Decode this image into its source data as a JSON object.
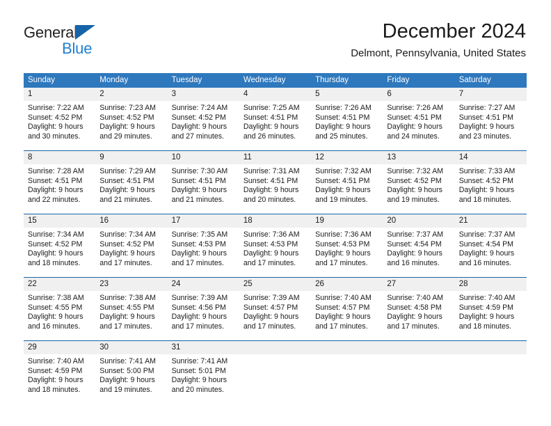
{
  "brand": {
    "name_part1": "General",
    "name_part2": "Blue",
    "accent_color": "#1f7fd0",
    "triangle_color": "#1564a7"
  },
  "header": {
    "title": "December 2024",
    "subtitle": "Delmont, Pennsylvania, United States"
  },
  "theme": {
    "header_row_bg": "#2e78bd",
    "header_row_text": "#ffffff",
    "week_divider": "#1564a7",
    "day_band_bg": "#f0f0f0"
  },
  "weekdays": [
    "Sunday",
    "Monday",
    "Tuesday",
    "Wednesday",
    "Thursday",
    "Friday",
    "Saturday"
  ],
  "weeks": [
    [
      {
        "day": "1",
        "sunrise": "Sunrise: 7:22 AM",
        "sunset": "Sunset: 4:52 PM",
        "daylight_line1": "Daylight: 9 hours",
        "daylight_line2": "and 30 minutes."
      },
      {
        "day": "2",
        "sunrise": "Sunrise: 7:23 AM",
        "sunset": "Sunset: 4:52 PM",
        "daylight_line1": "Daylight: 9 hours",
        "daylight_line2": "and 29 minutes."
      },
      {
        "day": "3",
        "sunrise": "Sunrise: 7:24 AM",
        "sunset": "Sunset: 4:52 PM",
        "daylight_line1": "Daylight: 9 hours",
        "daylight_line2": "and 27 minutes."
      },
      {
        "day": "4",
        "sunrise": "Sunrise: 7:25 AM",
        "sunset": "Sunset: 4:51 PM",
        "daylight_line1": "Daylight: 9 hours",
        "daylight_line2": "and 26 minutes."
      },
      {
        "day": "5",
        "sunrise": "Sunrise: 7:26 AM",
        "sunset": "Sunset: 4:51 PM",
        "daylight_line1": "Daylight: 9 hours",
        "daylight_line2": "and 25 minutes."
      },
      {
        "day": "6",
        "sunrise": "Sunrise: 7:26 AM",
        "sunset": "Sunset: 4:51 PM",
        "daylight_line1": "Daylight: 9 hours",
        "daylight_line2": "and 24 minutes."
      },
      {
        "day": "7",
        "sunrise": "Sunrise: 7:27 AM",
        "sunset": "Sunset: 4:51 PM",
        "daylight_line1": "Daylight: 9 hours",
        "daylight_line2": "and 23 minutes."
      }
    ],
    [
      {
        "day": "8",
        "sunrise": "Sunrise: 7:28 AM",
        "sunset": "Sunset: 4:51 PM",
        "daylight_line1": "Daylight: 9 hours",
        "daylight_line2": "and 22 minutes."
      },
      {
        "day": "9",
        "sunrise": "Sunrise: 7:29 AM",
        "sunset": "Sunset: 4:51 PM",
        "daylight_line1": "Daylight: 9 hours",
        "daylight_line2": "and 21 minutes."
      },
      {
        "day": "10",
        "sunrise": "Sunrise: 7:30 AM",
        "sunset": "Sunset: 4:51 PM",
        "daylight_line1": "Daylight: 9 hours",
        "daylight_line2": "and 21 minutes."
      },
      {
        "day": "11",
        "sunrise": "Sunrise: 7:31 AM",
        "sunset": "Sunset: 4:51 PM",
        "daylight_line1": "Daylight: 9 hours",
        "daylight_line2": "and 20 minutes."
      },
      {
        "day": "12",
        "sunrise": "Sunrise: 7:32 AM",
        "sunset": "Sunset: 4:51 PM",
        "daylight_line1": "Daylight: 9 hours",
        "daylight_line2": "and 19 minutes."
      },
      {
        "day": "13",
        "sunrise": "Sunrise: 7:32 AM",
        "sunset": "Sunset: 4:52 PM",
        "daylight_line1": "Daylight: 9 hours",
        "daylight_line2": "and 19 minutes."
      },
      {
        "day": "14",
        "sunrise": "Sunrise: 7:33 AM",
        "sunset": "Sunset: 4:52 PM",
        "daylight_line1": "Daylight: 9 hours",
        "daylight_line2": "and 18 minutes."
      }
    ],
    [
      {
        "day": "15",
        "sunrise": "Sunrise: 7:34 AM",
        "sunset": "Sunset: 4:52 PM",
        "daylight_line1": "Daylight: 9 hours",
        "daylight_line2": "and 18 minutes."
      },
      {
        "day": "16",
        "sunrise": "Sunrise: 7:34 AM",
        "sunset": "Sunset: 4:52 PM",
        "daylight_line1": "Daylight: 9 hours",
        "daylight_line2": "and 17 minutes."
      },
      {
        "day": "17",
        "sunrise": "Sunrise: 7:35 AM",
        "sunset": "Sunset: 4:53 PM",
        "daylight_line1": "Daylight: 9 hours",
        "daylight_line2": "and 17 minutes."
      },
      {
        "day": "18",
        "sunrise": "Sunrise: 7:36 AM",
        "sunset": "Sunset: 4:53 PM",
        "daylight_line1": "Daylight: 9 hours",
        "daylight_line2": "and 17 minutes."
      },
      {
        "day": "19",
        "sunrise": "Sunrise: 7:36 AM",
        "sunset": "Sunset: 4:53 PM",
        "daylight_line1": "Daylight: 9 hours",
        "daylight_line2": "and 17 minutes."
      },
      {
        "day": "20",
        "sunrise": "Sunrise: 7:37 AM",
        "sunset": "Sunset: 4:54 PM",
        "daylight_line1": "Daylight: 9 hours",
        "daylight_line2": "and 16 minutes."
      },
      {
        "day": "21",
        "sunrise": "Sunrise: 7:37 AM",
        "sunset": "Sunset: 4:54 PM",
        "daylight_line1": "Daylight: 9 hours",
        "daylight_line2": "and 16 minutes."
      }
    ],
    [
      {
        "day": "22",
        "sunrise": "Sunrise: 7:38 AM",
        "sunset": "Sunset: 4:55 PM",
        "daylight_line1": "Daylight: 9 hours",
        "daylight_line2": "and 16 minutes."
      },
      {
        "day": "23",
        "sunrise": "Sunrise: 7:38 AM",
        "sunset": "Sunset: 4:55 PM",
        "daylight_line1": "Daylight: 9 hours",
        "daylight_line2": "and 17 minutes."
      },
      {
        "day": "24",
        "sunrise": "Sunrise: 7:39 AM",
        "sunset": "Sunset: 4:56 PM",
        "daylight_line1": "Daylight: 9 hours",
        "daylight_line2": "and 17 minutes."
      },
      {
        "day": "25",
        "sunrise": "Sunrise: 7:39 AM",
        "sunset": "Sunset: 4:57 PM",
        "daylight_line1": "Daylight: 9 hours",
        "daylight_line2": "and 17 minutes."
      },
      {
        "day": "26",
        "sunrise": "Sunrise: 7:40 AM",
        "sunset": "Sunset: 4:57 PM",
        "daylight_line1": "Daylight: 9 hours",
        "daylight_line2": "and 17 minutes."
      },
      {
        "day": "27",
        "sunrise": "Sunrise: 7:40 AM",
        "sunset": "Sunset: 4:58 PM",
        "daylight_line1": "Daylight: 9 hours",
        "daylight_line2": "and 17 minutes."
      },
      {
        "day": "28",
        "sunrise": "Sunrise: 7:40 AM",
        "sunset": "Sunset: 4:59 PM",
        "daylight_line1": "Daylight: 9 hours",
        "daylight_line2": "and 18 minutes."
      }
    ],
    [
      {
        "day": "29",
        "sunrise": "Sunrise: 7:40 AM",
        "sunset": "Sunset: 4:59 PM",
        "daylight_line1": "Daylight: 9 hours",
        "daylight_line2": "and 18 minutes."
      },
      {
        "day": "30",
        "sunrise": "Sunrise: 7:41 AM",
        "sunset": "Sunset: 5:00 PM",
        "daylight_line1": "Daylight: 9 hours",
        "daylight_line2": "and 19 minutes."
      },
      {
        "day": "31",
        "sunrise": "Sunrise: 7:41 AM",
        "sunset": "Sunset: 5:01 PM",
        "daylight_line1": "Daylight: 9 hours",
        "daylight_line2": "and 20 minutes."
      },
      {
        "day": "",
        "sunrise": "",
        "sunset": "",
        "daylight_line1": "",
        "daylight_line2": ""
      },
      {
        "day": "",
        "sunrise": "",
        "sunset": "",
        "daylight_line1": "",
        "daylight_line2": ""
      },
      {
        "day": "",
        "sunrise": "",
        "sunset": "",
        "daylight_line1": "",
        "daylight_line2": ""
      },
      {
        "day": "",
        "sunrise": "",
        "sunset": "",
        "daylight_line1": "",
        "daylight_line2": ""
      }
    ]
  ]
}
